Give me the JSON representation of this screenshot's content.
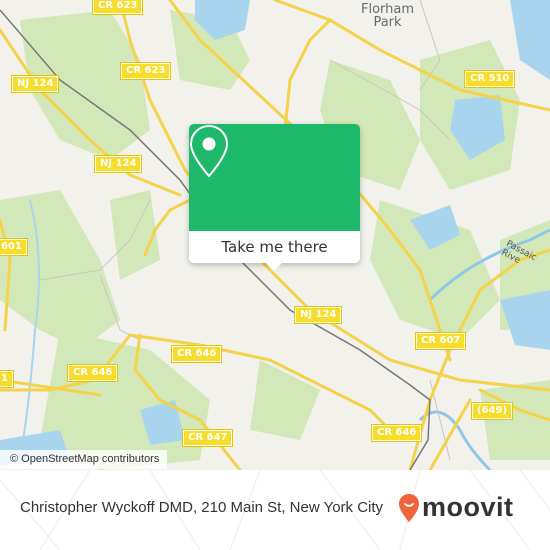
{
  "map": {
    "place_labels": [
      {
        "id": "florham-park",
        "text": "Florham\nPark"
      }
    ],
    "road_labels": [
      {
        "id": "cr623-top",
        "text": "CR 623"
      },
      {
        "id": "cr623",
        "text": "CR 623"
      },
      {
        "id": "cr510",
        "text": "CR 510"
      },
      {
        "id": "nj124-a",
        "text": "NJ 124"
      },
      {
        "id": "nj124-b",
        "text": "NJ 124"
      },
      {
        "id": "nj124-c",
        "text": "NJ 124"
      },
      {
        "id": "cr601",
        "text": "601"
      },
      {
        "id": "cr646-a",
        "text": "CR 646"
      },
      {
        "id": "cr646-b",
        "text": "CR 646"
      },
      {
        "id": "cr646-c",
        "text": "CR 646"
      },
      {
        "id": "cr647",
        "text": "CR 647"
      },
      {
        "id": "cr607",
        "text": "CR 607"
      },
      {
        "id": "r649",
        "text": "(649)"
      },
      {
        "id": "cr-left",
        "text": "1"
      }
    ],
    "water_labels": [
      {
        "id": "passaic",
        "text": "Passaic Rive"
      }
    ],
    "attribution": "© OpenStreetMap contributors",
    "colors": {
      "land": "#f2f1ec",
      "park": "#cfe6b0",
      "water": "#a9d4ee",
      "road": "#f6dc2b",
      "rail": "#777777"
    }
  },
  "popup": {
    "icon": "map-pin-icon",
    "button_label": "Take me there",
    "color": "#1db86a"
  },
  "footer": {
    "title": "Christopher Wyckoff DMD, 210 Main St, New York City",
    "logo_text": "moovit",
    "logo_icon": "moovit-pin-icon",
    "logo_color": "#f0643c"
  }
}
